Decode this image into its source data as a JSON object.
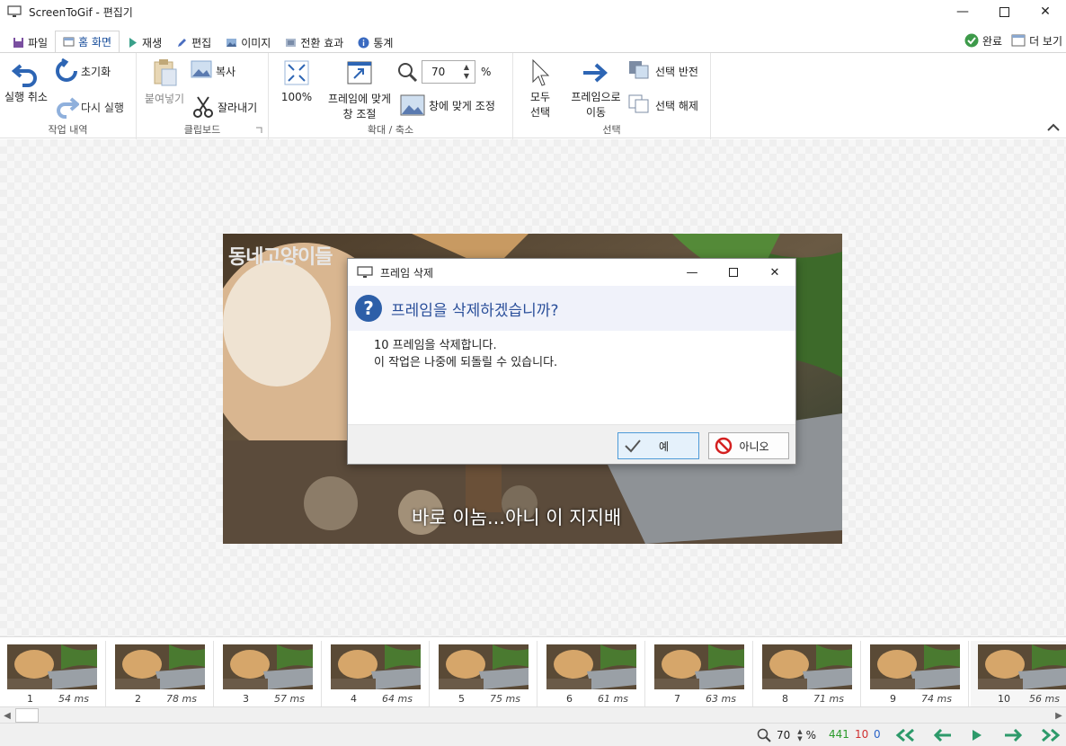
{
  "window": {
    "title": "ScreenToGif - 편집기"
  },
  "tabs": [
    {
      "label": "파일"
    },
    {
      "label": "홈 화면"
    },
    {
      "label": "재생"
    },
    {
      "label": "편집"
    },
    {
      "label": "이미지"
    },
    {
      "label": "전환 효과"
    },
    {
      "label": "통계"
    }
  ],
  "tabbar_right": {
    "done": "완료",
    "more": "더 보기"
  },
  "ribbon": {
    "history": {
      "label": "작업 내역",
      "undo": "실행 취소",
      "reset": "초기화",
      "redo": "다시 실행"
    },
    "clipboard": {
      "label": "클립보드",
      "paste": "붙여넣기",
      "copy": "복사",
      "cut": "잘라내기"
    },
    "zoom": {
      "label": "확대 / 축소",
      "full": "100%",
      "fit_line1": "프레임에 맞게",
      "fit_line2": "창 조절",
      "zoom_value": "70",
      "percent": "%",
      "fit_window": "창에 맞게 조정"
    },
    "select": {
      "label": "선택",
      "all_line1": "모두",
      "all_line2": "선택",
      "goto_line1": "프레임으로",
      "goto_line2": "이동",
      "invert": "선택 반전",
      "deselect": "선택 해제"
    }
  },
  "preview": {
    "logo": "동네고양이들",
    "caption": "바로 이놈...아니 이 지지배"
  },
  "dialog": {
    "title": "프레임 삭제",
    "header": "프레임을 삭제하겠습니까?",
    "body_line1": "10 프레임을 삭제합니다.",
    "body_line2": "이 작업은 나중에 되돌릴 수 있습니다.",
    "yes": "예",
    "no": "아니오"
  },
  "frames": [
    {
      "num": "1",
      "ms": "54 ms"
    },
    {
      "num": "2",
      "ms": "78 ms"
    },
    {
      "num": "3",
      "ms": "57 ms"
    },
    {
      "num": "4",
      "ms": "64 ms"
    },
    {
      "num": "5",
      "ms": "75 ms"
    },
    {
      "num": "6",
      "ms": "61 ms"
    },
    {
      "num": "7",
      "ms": "63 ms"
    },
    {
      "num": "8",
      "ms": "71 ms"
    },
    {
      "num": "9",
      "ms": "74 ms"
    },
    {
      "num": "10",
      "ms": "56 ms"
    }
  ],
  "status": {
    "zoom": "70",
    "percent": "%",
    "total": "441",
    "selected": "10",
    "zero": "0"
  },
  "colors": {
    "accent": "#1a73c8",
    "total": "#2a9a2a",
    "selected": "#d03030",
    "zero": "#2a63c8"
  }
}
